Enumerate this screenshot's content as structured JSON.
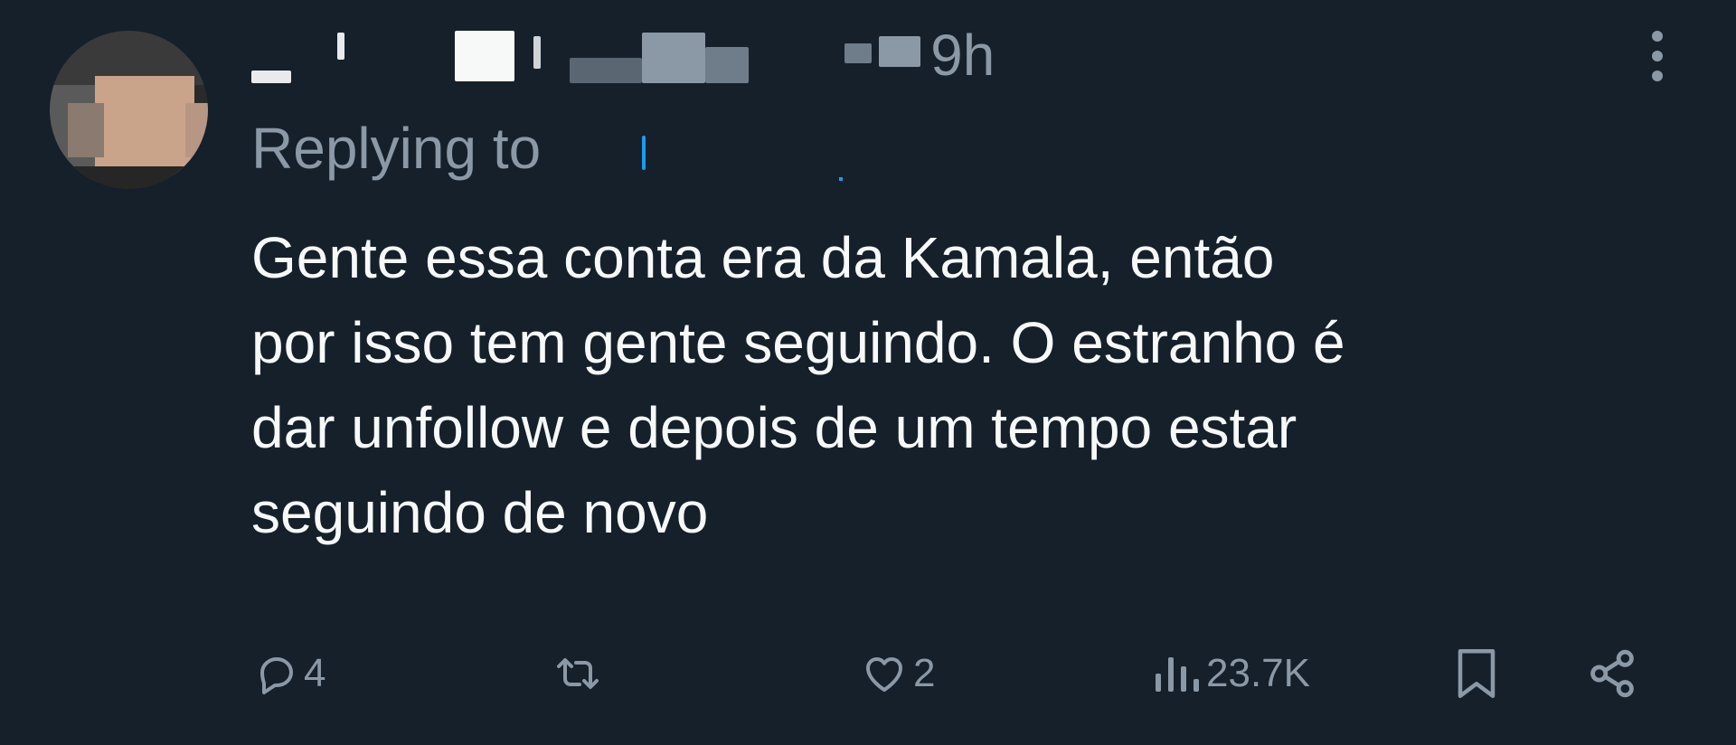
{
  "tweet": {
    "time": "· 9h",
    "replying_label": "Replying to",
    "text": "Gente essa conta era da Kamala, então\npor isso tem gente seguindo. O estranho é\ndar unfollow e depois de um tempo estar\nseguindo de novo",
    "colors": {
      "background": "#15202b",
      "text": "#f7f9f9",
      "secondary": "#8b98a5",
      "link": "#1d9bf0"
    }
  },
  "actions": {
    "reply_count": "4",
    "retweet_count": "",
    "like_count": "2",
    "views_count": "23.7K",
    "icons": [
      "reply-icon",
      "retweet-icon",
      "heart-icon",
      "views-icon",
      "bookmark-icon",
      "share-icon"
    ]
  }
}
